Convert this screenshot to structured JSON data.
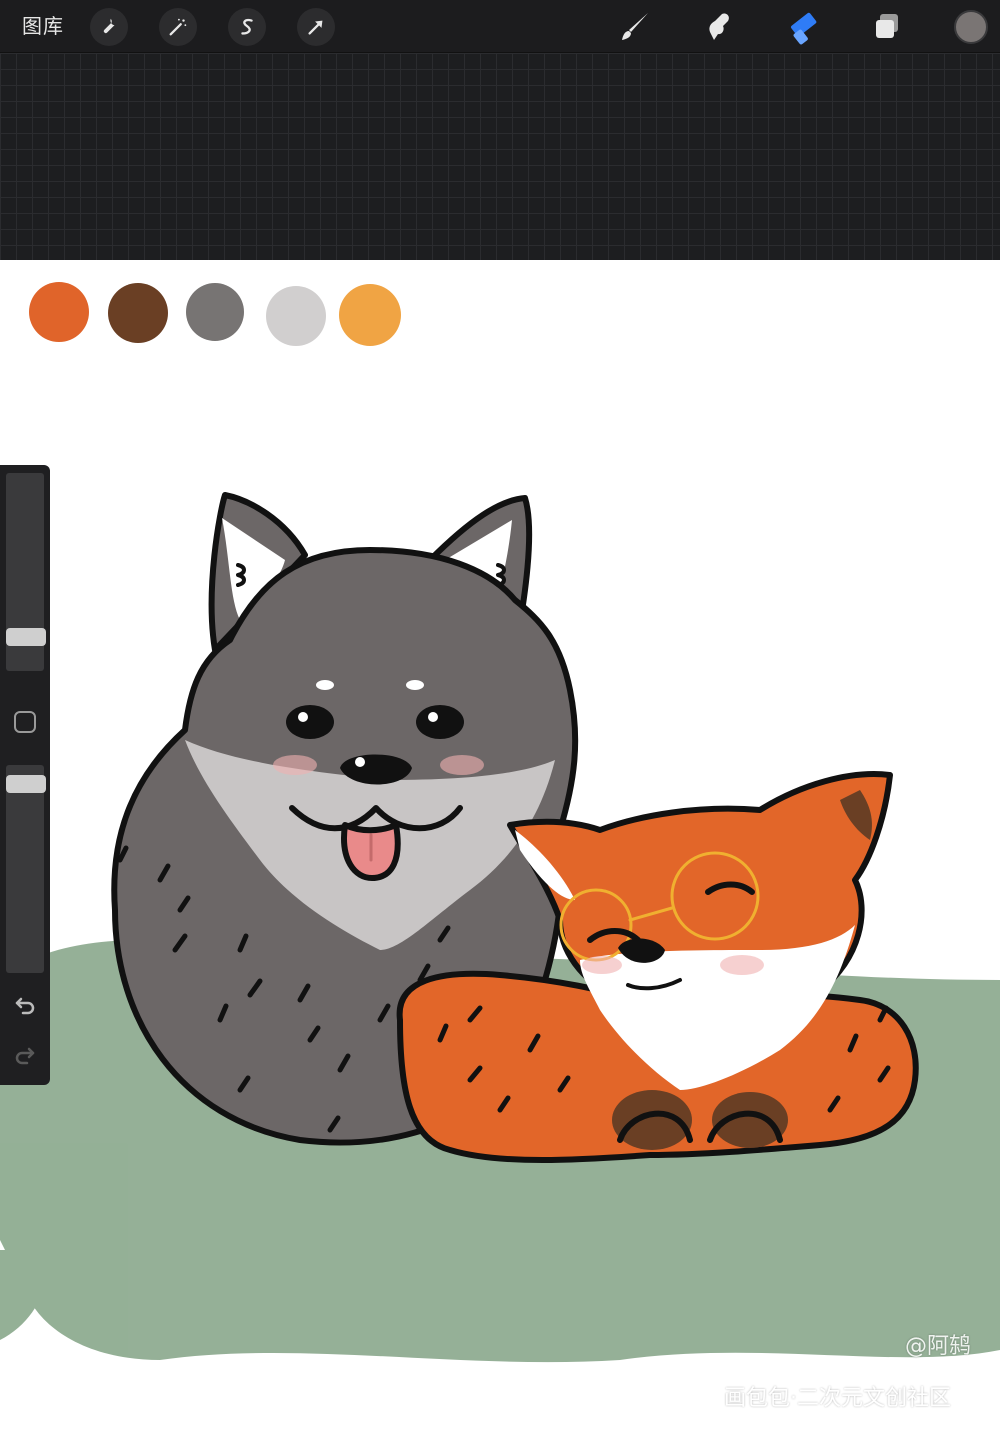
{
  "toolbar": {
    "gallery_label": "图库",
    "left_tools": [
      "wrench-icon",
      "magic-wand-icon",
      "selection-icon",
      "transform-arrow-icon"
    ],
    "right_tools": [
      "brush-icon",
      "smudge-icon",
      "eraser-icon",
      "layers-icon"
    ],
    "active_tool": "eraser-icon",
    "accent_color": "#2f7cf6",
    "current_color": "#7a7574"
  },
  "palette": {
    "swatches": [
      "#e0642a",
      "#6a3f24",
      "#777473",
      "#d1cfcf",
      "#f0a444"
    ]
  },
  "colors": {
    "grass": "#8fac91",
    "wolf_body": "#6c6767",
    "wolf_chest": "#c8c5c5",
    "fox_body": "#e26629",
    "fox_white": "#ffffff",
    "glasses": "#f0b030",
    "outline": "#111111"
  },
  "sidebar": {
    "brush_size_level": 0.14,
    "opacity_level": 0.95
  },
  "watermark": {
    "author": "@阿鸫",
    "site": "画包包·二次元文创社区"
  }
}
